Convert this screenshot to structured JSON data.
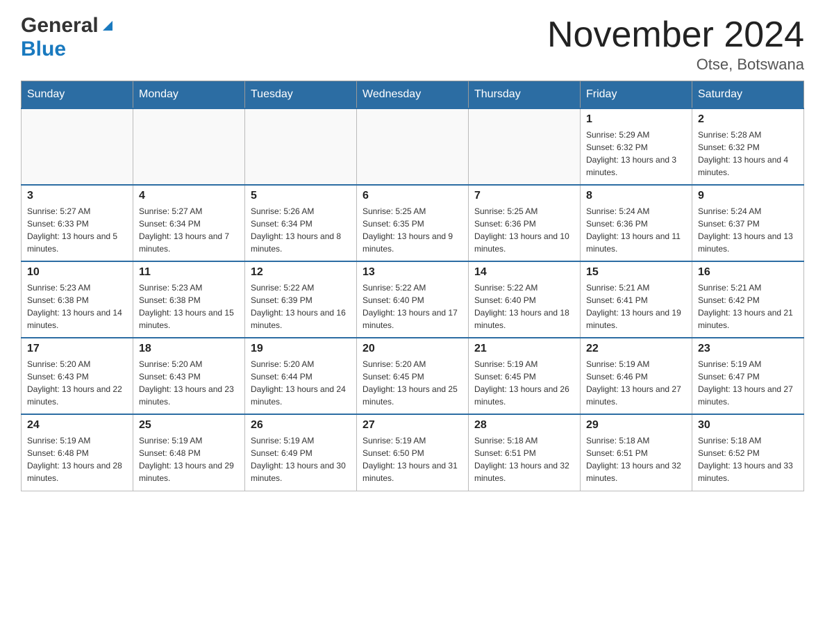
{
  "logo": {
    "text_general": "General",
    "text_blue": "Blue",
    "triangle_desc": "blue triangle logo"
  },
  "title": {
    "month_year": "November 2024",
    "location": "Otse, Botswana"
  },
  "weekdays": [
    "Sunday",
    "Monday",
    "Tuesday",
    "Wednesday",
    "Thursday",
    "Friday",
    "Saturday"
  ],
  "weeks": [
    [
      {
        "day": "",
        "sunrise": "",
        "sunset": "",
        "daylight": ""
      },
      {
        "day": "",
        "sunrise": "",
        "sunset": "",
        "daylight": ""
      },
      {
        "day": "",
        "sunrise": "",
        "sunset": "",
        "daylight": ""
      },
      {
        "day": "",
        "sunrise": "",
        "sunset": "",
        "daylight": ""
      },
      {
        "day": "",
        "sunrise": "",
        "sunset": "",
        "daylight": ""
      },
      {
        "day": "1",
        "sunrise": "Sunrise: 5:29 AM",
        "sunset": "Sunset: 6:32 PM",
        "daylight": "Daylight: 13 hours and 3 minutes."
      },
      {
        "day": "2",
        "sunrise": "Sunrise: 5:28 AM",
        "sunset": "Sunset: 6:32 PM",
        "daylight": "Daylight: 13 hours and 4 minutes."
      }
    ],
    [
      {
        "day": "3",
        "sunrise": "Sunrise: 5:27 AM",
        "sunset": "Sunset: 6:33 PM",
        "daylight": "Daylight: 13 hours and 5 minutes."
      },
      {
        "day": "4",
        "sunrise": "Sunrise: 5:27 AM",
        "sunset": "Sunset: 6:34 PM",
        "daylight": "Daylight: 13 hours and 7 minutes."
      },
      {
        "day": "5",
        "sunrise": "Sunrise: 5:26 AM",
        "sunset": "Sunset: 6:34 PM",
        "daylight": "Daylight: 13 hours and 8 minutes."
      },
      {
        "day": "6",
        "sunrise": "Sunrise: 5:25 AM",
        "sunset": "Sunset: 6:35 PM",
        "daylight": "Daylight: 13 hours and 9 minutes."
      },
      {
        "day": "7",
        "sunrise": "Sunrise: 5:25 AM",
        "sunset": "Sunset: 6:36 PM",
        "daylight": "Daylight: 13 hours and 10 minutes."
      },
      {
        "day": "8",
        "sunrise": "Sunrise: 5:24 AM",
        "sunset": "Sunset: 6:36 PM",
        "daylight": "Daylight: 13 hours and 11 minutes."
      },
      {
        "day": "9",
        "sunrise": "Sunrise: 5:24 AM",
        "sunset": "Sunset: 6:37 PM",
        "daylight": "Daylight: 13 hours and 13 minutes."
      }
    ],
    [
      {
        "day": "10",
        "sunrise": "Sunrise: 5:23 AM",
        "sunset": "Sunset: 6:38 PM",
        "daylight": "Daylight: 13 hours and 14 minutes."
      },
      {
        "day": "11",
        "sunrise": "Sunrise: 5:23 AM",
        "sunset": "Sunset: 6:38 PM",
        "daylight": "Daylight: 13 hours and 15 minutes."
      },
      {
        "day": "12",
        "sunrise": "Sunrise: 5:22 AM",
        "sunset": "Sunset: 6:39 PM",
        "daylight": "Daylight: 13 hours and 16 minutes."
      },
      {
        "day": "13",
        "sunrise": "Sunrise: 5:22 AM",
        "sunset": "Sunset: 6:40 PM",
        "daylight": "Daylight: 13 hours and 17 minutes."
      },
      {
        "day": "14",
        "sunrise": "Sunrise: 5:22 AM",
        "sunset": "Sunset: 6:40 PM",
        "daylight": "Daylight: 13 hours and 18 minutes."
      },
      {
        "day": "15",
        "sunrise": "Sunrise: 5:21 AM",
        "sunset": "Sunset: 6:41 PM",
        "daylight": "Daylight: 13 hours and 19 minutes."
      },
      {
        "day": "16",
        "sunrise": "Sunrise: 5:21 AM",
        "sunset": "Sunset: 6:42 PM",
        "daylight": "Daylight: 13 hours and 21 minutes."
      }
    ],
    [
      {
        "day": "17",
        "sunrise": "Sunrise: 5:20 AM",
        "sunset": "Sunset: 6:43 PM",
        "daylight": "Daylight: 13 hours and 22 minutes."
      },
      {
        "day": "18",
        "sunrise": "Sunrise: 5:20 AM",
        "sunset": "Sunset: 6:43 PM",
        "daylight": "Daylight: 13 hours and 23 minutes."
      },
      {
        "day": "19",
        "sunrise": "Sunrise: 5:20 AM",
        "sunset": "Sunset: 6:44 PM",
        "daylight": "Daylight: 13 hours and 24 minutes."
      },
      {
        "day": "20",
        "sunrise": "Sunrise: 5:20 AM",
        "sunset": "Sunset: 6:45 PM",
        "daylight": "Daylight: 13 hours and 25 minutes."
      },
      {
        "day": "21",
        "sunrise": "Sunrise: 5:19 AM",
        "sunset": "Sunset: 6:45 PM",
        "daylight": "Daylight: 13 hours and 26 minutes."
      },
      {
        "day": "22",
        "sunrise": "Sunrise: 5:19 AM",
        "sunset": "Sunset: 6:46 PM",
        "daylight": "Daylight: 13 hours and 27 minutes."
      },
      {
        "day": "23",
        "sunrise": "Sunrise: 5:19 AM",
        "sunset": "Sunset: 6:47 PM",
        "daylight": "Daylight: 13 hours and 27 minutes."
      }
    ],
    [
      {
        "day": "24",
        "sunrise": "Sunrise: 5:19 AM",
        "sunset": "Sunset: 6:48 PM",
        "daylight": "Daylight: 13 hours and 28 minutes."
      },
      {
        "day": "25",
        "sunrise": "Sunrise: 5:19 AM",
        "sunset": "Sunset: 6:48 PM",
        "daylight": "Daylight: 13 hours and 29 minutes."
      },
      {
        "day": "26",
        "sunrise": "Sunrise: 5:19 AM",
        "sunset": "Sunset: 6:49 PM",
        "daylight": "Daylight: 13 hours and 30 minutes."
      },
      {
        "day": "27",
        "sunrise": "Sunrise: 5:19 AM",
        "sunset": "Sunset: 6:50 PM",
        "daylight": "Daylight: 13 hours and 31 minutes."
      },
      {
        "day": "28",
        "sunrise": "Sunrise: 5:18 AM",
        "sunset": "Sunset: 6:51 PM",
        "daylight": "Daylight: 13 hours and 32 minutes."
      },
      {
        "day": "29",
        "sunrise": "Sunrise: 5:18 AM",
        "sunset": "Sunset: 6:51 PM",
        "daylight": "Daylight: 13 hours and 32 minutes."
      },
      {
        "day": "30",
        "sunrise": "Sunrise: 5:18 AM",
        "sunset": "Sunset: 6:52 PM",
        "daylight": "Daylight: 13 hours and 33 minutes."
      }
    ]
  ]
}
